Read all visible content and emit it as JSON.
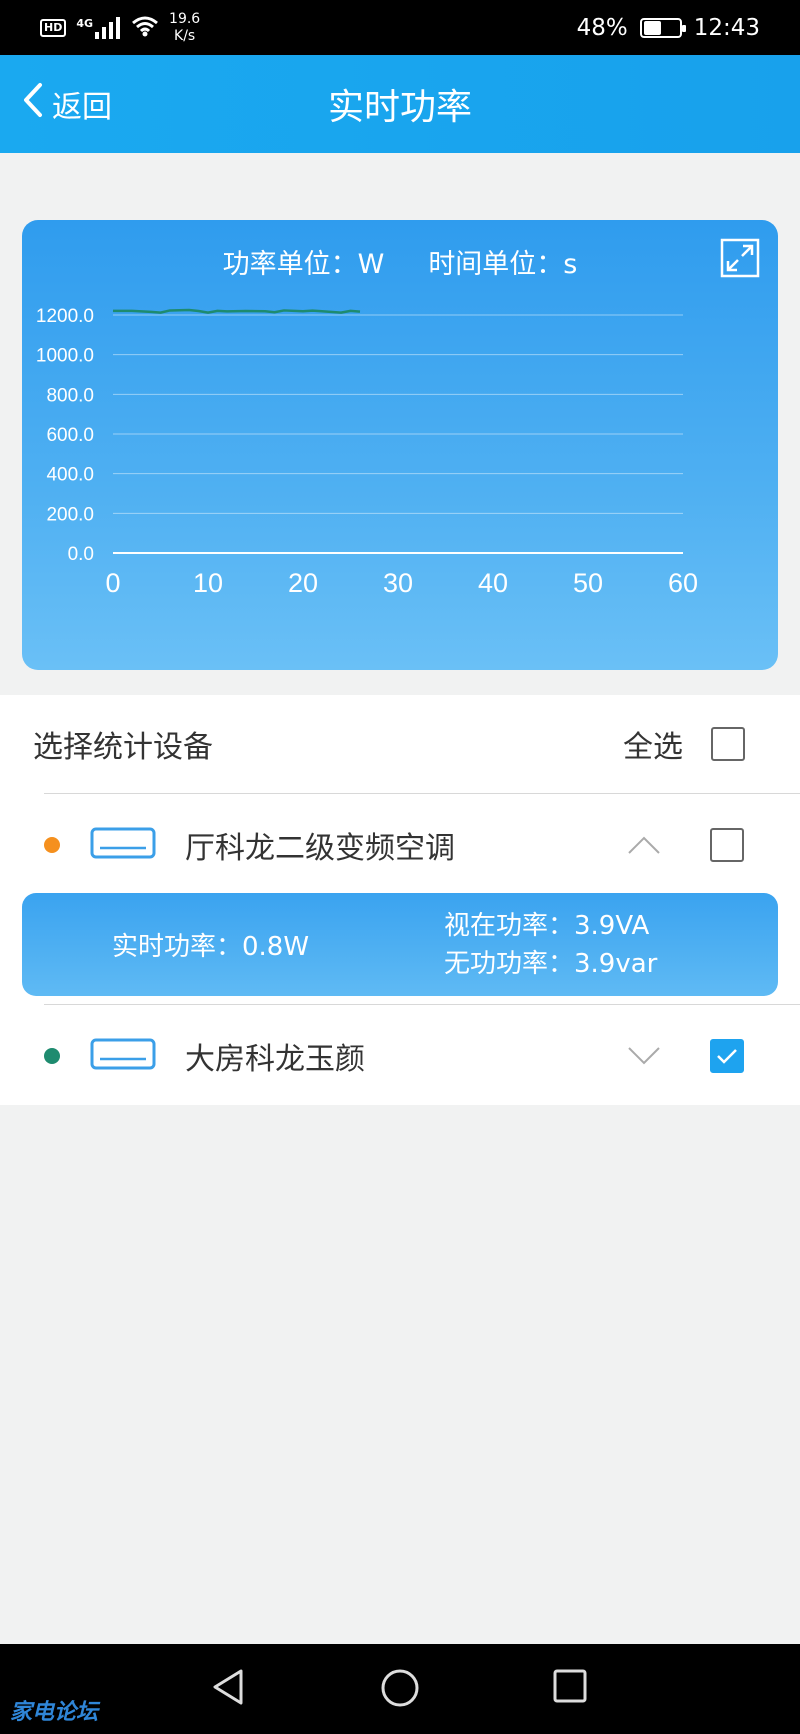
{
  "status_bar": {
    "hd": "HD",
    "network": "4G",
    "speed_value": "19.6",
    "speed_unit": "K/s",
    "battery": "48%",
    "battery_level": 0.48,
    "time": "12:43"
  },
  "header": {
    "back_label": "返回",
    "title": "实时功率"
  },
  "chart": {
    "power_unit": "功率单位：W",
    "time_unit": "时间单位：s"
  },
  "chart_data": {
    "type": "line",
    "title": "",
    "xlabel": "",
    "ylabel": "",
    "xlim": [
      0,
      60
    ],
    "ylim": [
      0,
      1200
    ],
    "x_ticks": [
      "0",
      "10",
      "20",
      "30",
      "40",
      "50",
      "60"
    ],
    "y_ticks": [
      "0.0",
      "200.0",
      "400.0",
      "600.0",
      "800.0",
      "1000.0",
      "1200.0"
    ],
    "grid": true,
    "series": [
      {
        "color": "#1e8b6f",
        "x": [
          0,
          2,
          4,
          5,
          6,
          8,
          9,
          10,
          11,
          12,
          14,
          16,
          17,
          18,
          20,
          21,
          22,
          24,
          25,
          26
        ],
        "y": [
          1221,
          1221,
          1216,
          1212,
          1223,
          1225,
          1220,
          1212,
          1221,
          1218,
          1220,
          1219,
          1214,
          1223,
          1219,
          1222,
          1219,
          1212,
          1221,
          1217
        ]
      }
    ]
  },
  "devices": {
    "section_title": "选择统计设备",
    "select_all_label": "全选",
    "select_all_checked": false,
    "items": [
      {
        "name": "厅科龙二级变频空调",
        "dot_color": "#f5901e",
        "expanded": true,
        "checked": false,
        "details": {
          "realtime_power": "实时功率：0.8W",
          "apparent_power": "视在功率：3.9VA",
          "reactive_power": "无功功率：3.9var"
        }
      },
      {
        "name": "大房科龙玉颜",
        "dot_color": "#1e8b6f",
        "expanded": false,
        "checked": true
      }
    ]
  },
  "nav": {
    "watermark": "家电论坛"
  }
}
